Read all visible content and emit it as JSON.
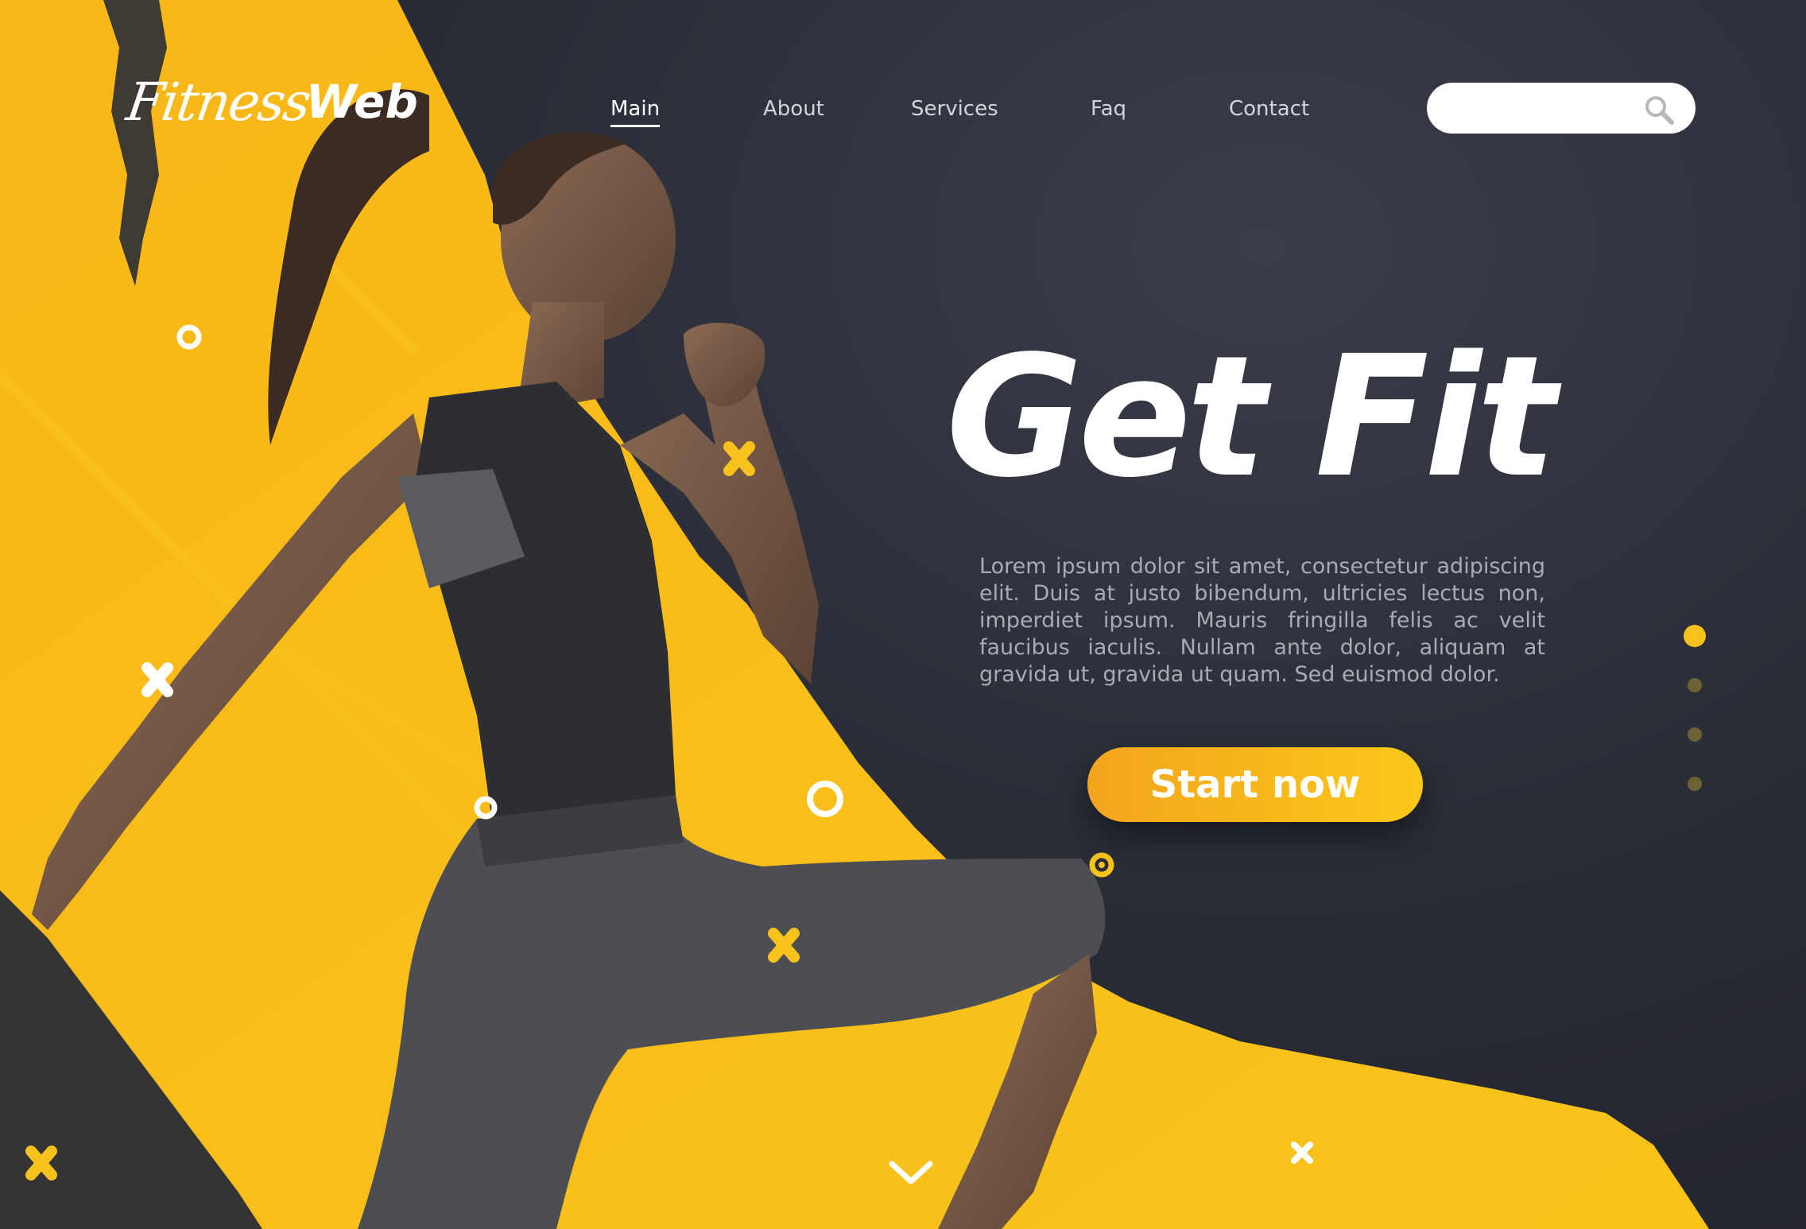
{
  "brand": {
    "logo_script": "Fitness",
    "logo_bold": "Web"
  },
  "nav": {
    "items": [
      {
        "label": "Main",
        "active": true
      },
      {
        "label": "About",
        "active": false
      },
      {
        "label": "Services",
        "active": false
      },
      {
        "label": "Faq",
        "active": false
      },
      {
        "label": "Contact",
        "active": false
      }
    ]
  },
  "search": {
    "placeholder": "",
    "icon": "search-icon"
  },
  "hero": {
    "title": "Get Fit",
    "body": "Lorem ipsum dolor sit amet, consectetur adipiscing elit. Duis at justo bibendum, ultricies lectus non, imperdiet ipsum. Mauris fringilla felis ac velit faucibus iaculis. Nullam ante dolor, aliquam at gravida ut, gravida ut quam. Sed euismod dolor.",
    "cta_label": "Start now"
  },
  "slider": {
    "total": 4,
    "active_index": 0
  },
  "colors": {
    "accent": "#f7c21b",
    "accent_dark": "#f3a51d",
    "background": "#2a2c36",
    "text_muted": "#a9abb4"
  },
  "decor": {
    "image": "woman-running-photo",
    "shapes": [
      "x-mark-icon",
      "ring-icon",
      "diagonal-line"
    ]
  }
}
